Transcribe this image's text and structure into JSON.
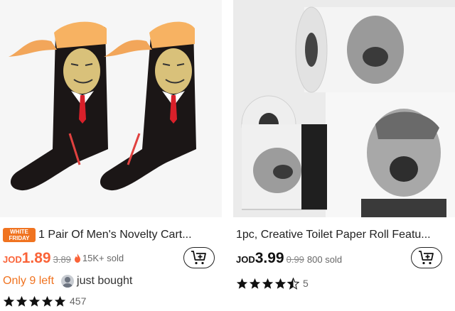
{
  "products": [
    {
      "badge": {
        "line1": "WHITE",
        "line2": "FRIDAY"
      },
      "title": "1 Pair Of Men's Novelty Cart...",
      "currency": "JOD",
      "price": "1.89",
      "original_price": "3.89",
      "sold": "15K+ sold",
      "stock_text": "Only 9 left",
      "social_text": "just bought",
      "rating": 5,
      "rating_count": "457",
      "image_icon": "novelty-socks-image"
    },
    {
      "title": "1pc, Creative Toilet Paper Roll Featu...",
      "currency": "JOD",
      "price": "3.99",
      "original_price": "0.99",
      "sold": "800 sold",
      "rating": 4.5,
      "rating_count": "5",
      "image_icon": "toilet-paper-image"
    }
  ],
  "colors": {
    "accent": "#fa6338",
    "badge": "#f07320",
    "text": "#222222"
  }
}
